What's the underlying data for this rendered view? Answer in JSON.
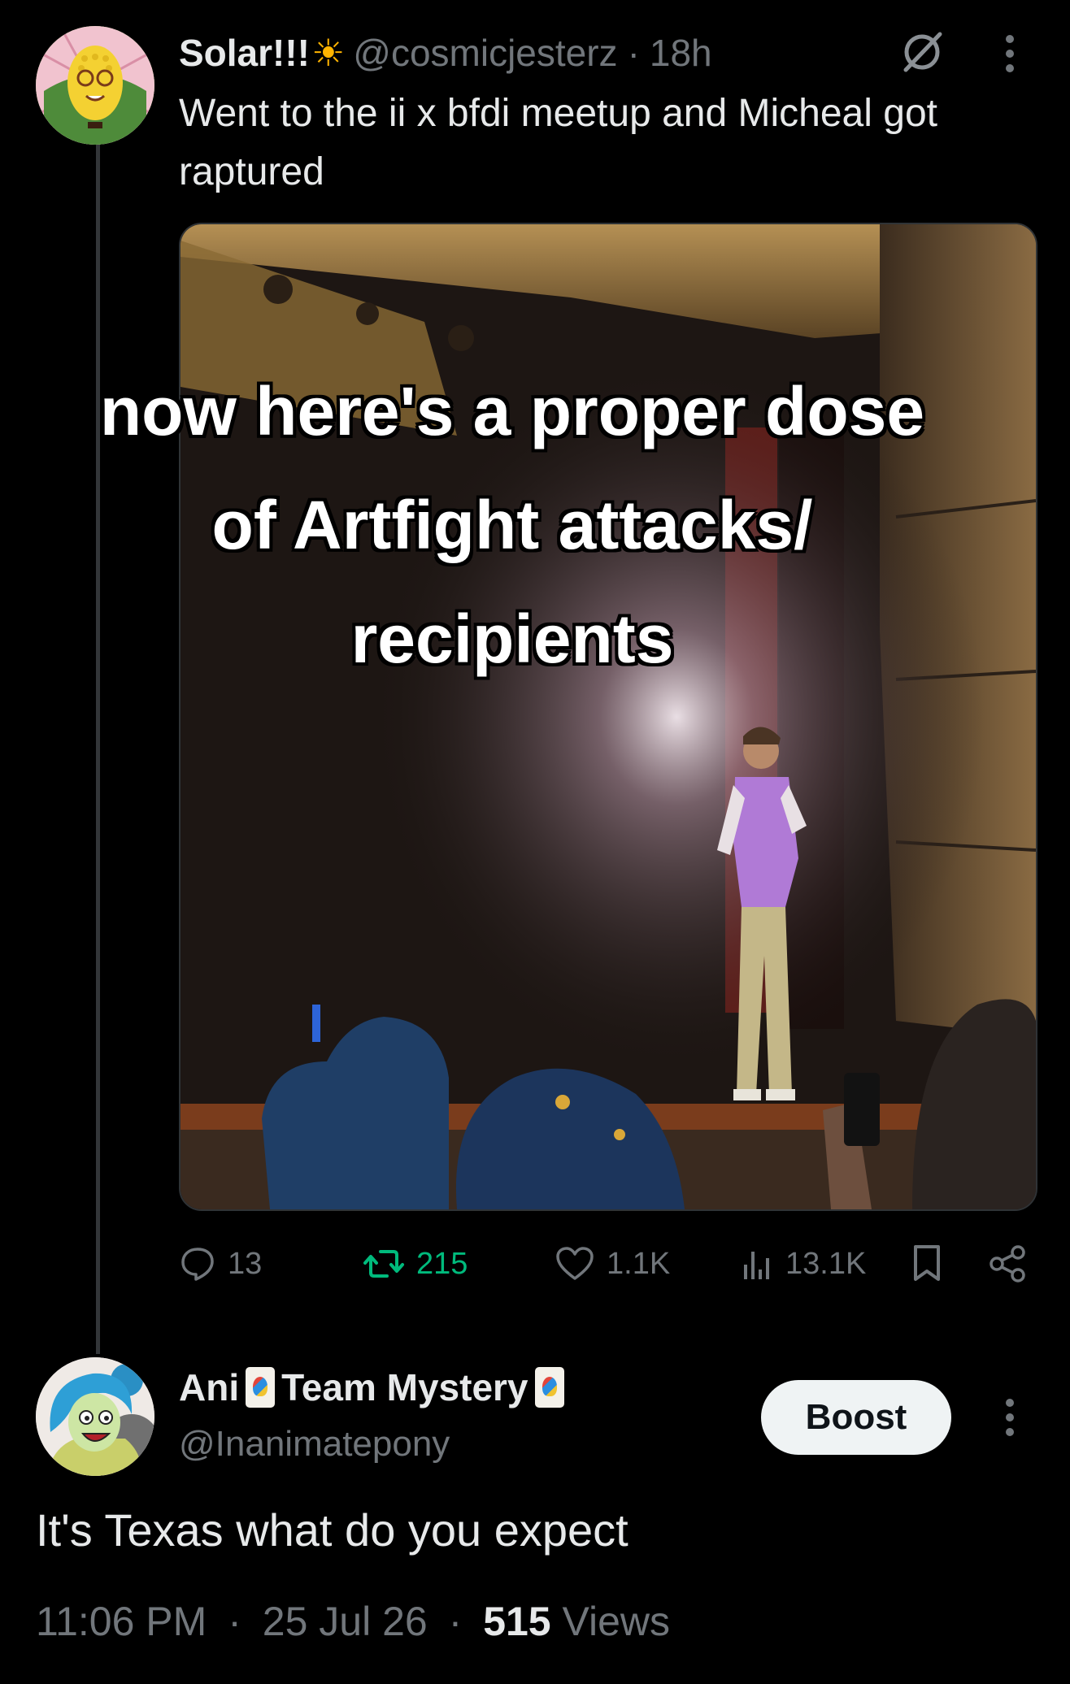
{
  "tweet": {
    "display_name": "Solar!!!",
    "name_emoji": "sun",
    "handle": "@cosmicjesterz",
    "separator": "·",
    "time": "18h",
    "text": "Went to the ii x bfdi meetup and Micheal got raptured",
    "media": {
      "caption_lines": [
        "now here's a proper dose",
        "of Artfight attacks/",
        "recipients"
      ]
    },
    "actions": {
      "replies": "13",
      "reposts": "215",
      "likes": "1.1K",
      "views": "13.1K"
    },
    "icons": [
      "grok-icon",
      "more-icon",
      "reply-icon",
      "repost-icon",
      "like-icon",
      "views-icon",
      "bookmark-icon",
      "share-icon"
    ]
  },
  "reply": {
    "display_name_part1": "Ani",
    "display_name_part2": "Team Mystery",
    "name_emojis": [
      "joker-card",
      "joker-card"
    ],
    "handle": "@Inanimatepony",
    "boost_label": "Boost",
    "text": "It's Texas what do you expect",
    "time": "11:06 PM",
    "date": "25 Jul 26",
    "separator": "·",
    "views_count": "515",
    "views_label": "Views"
  },
  "colors": {
    "background": "#000000",
    "text": "#e7e9ea",
    "muted": "#71767b",
    "repost_green": "#00ba7c",
    "button_bg": "#eff3f4"
  }
}
